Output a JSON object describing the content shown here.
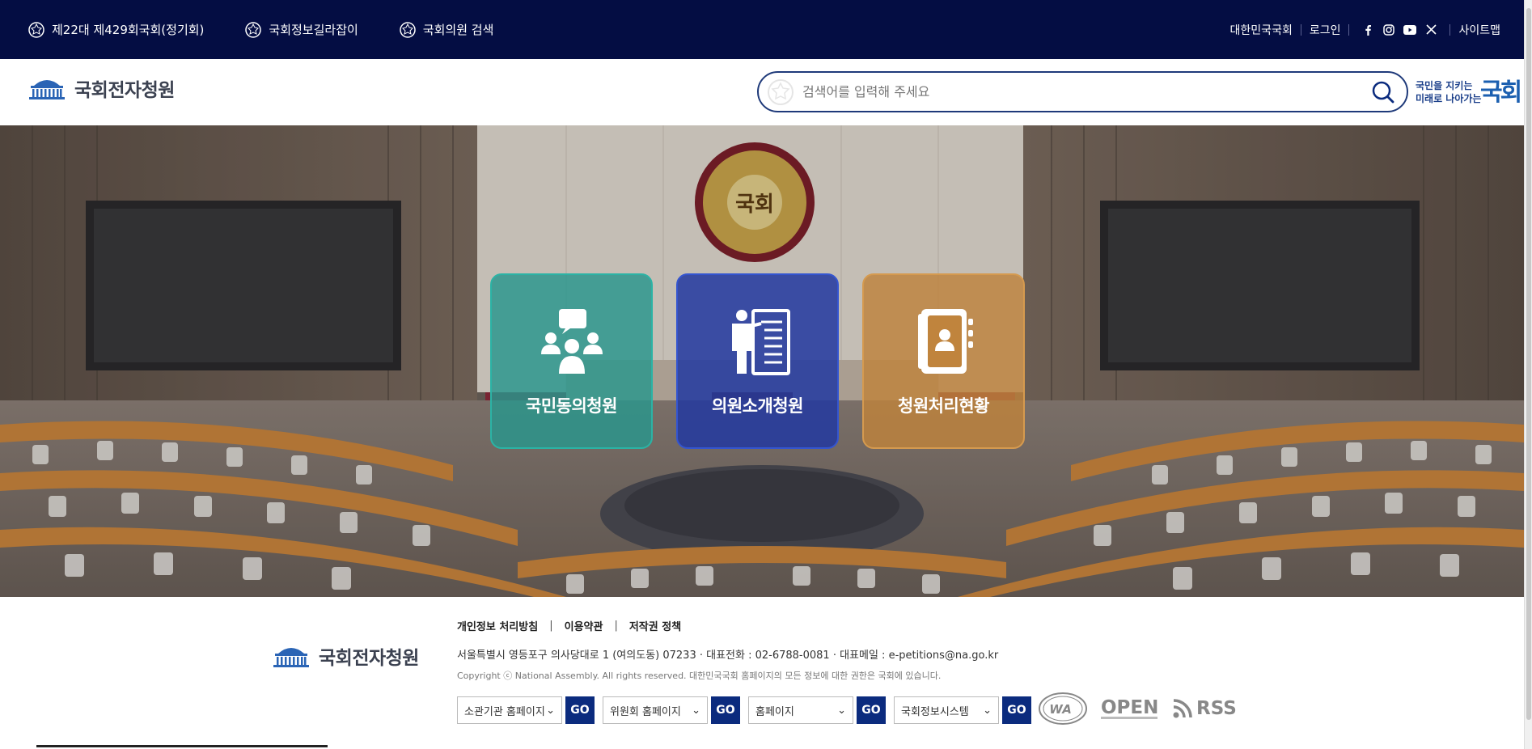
{
  "topbar": {
    "links": [
      {
        "label": "제22대 제429회국회(정기회)",
        "icon": "assembly-emblem-icon"
      },
      {
        "label": "국회정보길라잡이",
        "icon": "assembly-emblem-icon"
      },
      {
        "label": "국회의원 검색",
        "icon": "assembly-emblem-icon"
      }
    ],
    "right": {
      "assembly": "대한민국국회",
      "login": "로그인",
      "social": [
        "facebook-icon",
        "instagram-icon",
        "youtube-icon",
        "x-icon"
      ],
      "sitemap": "사이트맵"
    }
  },
  "header": {
    "logo_title": "국회전자청원",
    "search_placeholder": "검색어를 입력해 주세요",
    "slogan_line1": "국민을 지키는",
    "slogan_line2": "미래로 나아가는",
    "slogan_big": "국회"
  },
  "hero": {
    "emblem_text": "국회",
    "cards": [
      {
        "label": "국민동의청원",
        "icon": "discussion-people-icon",
        "color": "#2b9c91"
      },
      {
        "label": "의원소개청원",
        "icon": "presenter-board-icon",
        "color": "#2438a0"
      },
      {
        "label": "청원처리현황",
        "icon": "contact-book-icon",
        "color": "#c0843d"
      }
    ]
  },
  "footer": {
    "logo_title": "국회전자청원",
    "links": [
      "개인정보 처리방침",
      "이용약관",
      "저작권 정책"
    ],
    "address": "서울특별시 영등포구 의사당대로 1 (여의도동) 07233 · 대표전화 : 02-6788-0081 · 대표메일 : e-petitions@na.go.kr",
    "copyright": "Copyright ⓒ National Assembly. All rights reserved. 대한민국국회 홈페이지의 모든 정보에 대한 권한은 국회에 있습니다.",
    "selects": [
      {
        "value": "소관기관 홈페이지",
        "go": "GO"
      },
      {
        "value": "위원회 홈페이지",
        "go": "GO"
      },
      {
        "value": "홈페이지",
        "go": "GO"
      },
      {
        "value": "국회정보시스템",
        "go": "GO"
      }
    ],
    "badges": {
      "wa": "WA",
      "open": "OPEN",
      "rss": "RSS"
    }
  },
  "colors": {
    "topbar": "#040d43",
    "accent": "#0b2b7e",
    "search_border": "#1f3a7a"
  }
}
